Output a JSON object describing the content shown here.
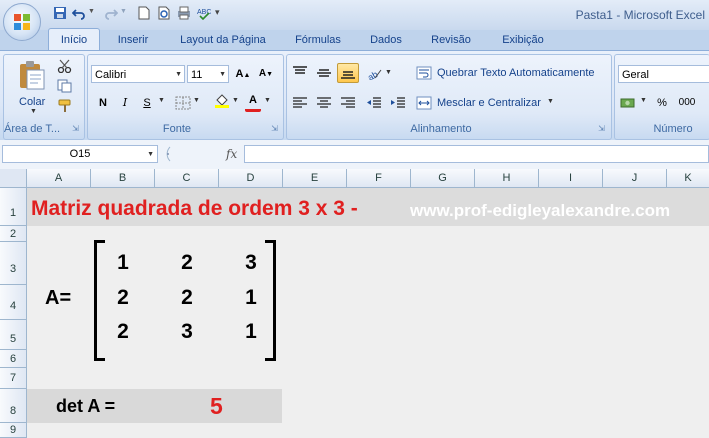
{
  "app": {
    "title": "Pasta1 - Microsoft Excel"
  },
  "tabs": [
    "Início",
    "Inserir",
    "Layout da Página",
    "Fórmulas",
    "Dados",
    "Revisão",
    "Exibição"
  ],
  "ribbon": {
    "clipboard": {
      "paste_label": "Colar",
      "group_label": "Área de T..."
    },
    "font": {
      "font_name": "Calibri",
      "font_size": "11",
      "bold": "N",
      "italic": "I",
      "underline": "S",
      "group_label": "Fonte"
    },
    "alignment": {
      "wrap_text": "Quebrar Texto Automaticamente",
      "merge_center": "Mesclar e Centralizar",
      "group_label": "Alinhamento"
    },
    "number": {
      "format": "Geral",
      "percent": "%",
      "thousands": "000",
      "group_label": "Número"
    }
  },
  "formula_bar": {
    "name_box": "O15",
    "fx_label": "fx",
    "formula": ""
  },
  "columns": [
    "A",
    "B",
    "C",
    "D",
    "E",
    "F",
    "G",
    "H",
    "I",
    "J",
    "K"
  ],
  "rows": [
    "1",
    "2",
    "3",
    "4",
    "5",
    "6",
    "7",
    "8",
    "9"
  ],
  "sheet": {
    "title": "Matriz quadrada de ordem 3 x 3 -",
    "url": "www.prof-edigleyalexandre.com",
    "matrix_label": "A=",
    "matrix": [
      [
        "1",
        "2",
        "3"
      ],
      [
        "2",
        "2",
        "1"
      ],
      [
        "2",
        "3",
        "1"
      ]
    ],
    "det_label": "det A =",
    "det_value": "5"
  },
  "colors": {
    "accent_red": "#e02020",
    "ribbon_blue": "#15428b"
  }
}
